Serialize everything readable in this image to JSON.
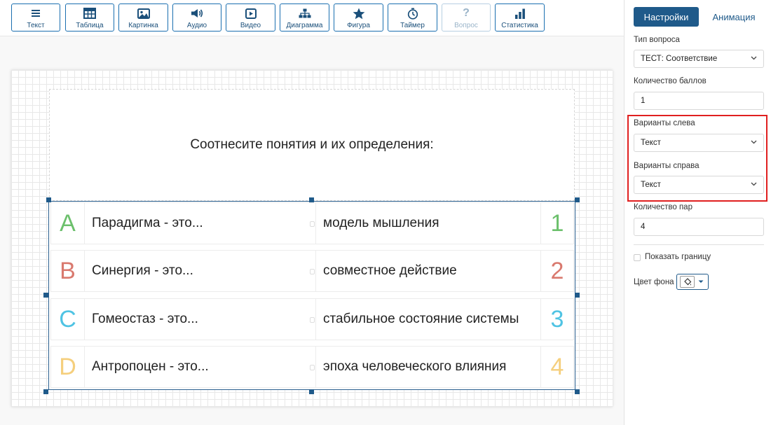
{
  "toolbar": {
    "items": [
      {
        "label": "Текст",
        "icon": "text-lines-icon",
        "disabled": false
      },
      {
        "label": "Таблица",
        "icon": "table-icon",
        "disabled": false
      },
      {
        "label": "Картинка",
        "icon": "image-icon",
        "disabled": false
      },
      {
        "label": "Аудио",
        "icon": "speaker-icon",
        "disabled": false
      },
      {
        "label": "Видео",
        "icon": "play-icon",
        "disabled": false
      },
      {
        "label": "Диаграмма",
        "icon": "hierarchy-icon",
        "disabled": false
      },
      {
        "label": "Фигура",
        "icon": "star-icon",
        "disabled": false
      },
      {
        "label": "Таймер",
        "icon": "stopwatch-icon",
        "disabled": false
      },
      {
        "label": "Вопрос",
        "icon": "question-icon",
        "disabled": true
      },
      {
        "label": "Статистика",
        "icon": "bar-chart-icon",
        "disabled": false
      }
    ]
  },
  "question": {
    "text": "Соотнесите понятия и их определения:",
    "pairs": [
      {
        "letter": "A",
        "letter_color": "#6cc06c",
        "left": "Парадигма - это...",
        "right": "модель мышления",
        "number": "1",
        "number_color": "#6cc06c"
      },
      {
        "letter": "B",
        "letter_color": "#d9796e",
        "left": "Синергия - это...",
        "right": "совместное действие",
        "number": "2",
        "number_color": "#d9796e"
      },
      {
        "letter": "C",
        "letter_color": "#4fc3e3",
        "left": "Гомеостаз - это...",
        "right": "стабильное состояние системы",
        "number": "3",
        "number_color": "#4fc3e3"
      },
      {
        "letter": "D",
        "letter_color": "#f5cf7d",
        "left": "Антропоцен - это...",
        "right": "эпоха человеческого влияния",
        "number": "4",
        "number_color": "#f5cf7d"
      }
    ]
  },
  "panel": {
    "tab_settings": "Настройки",
    "tab_animation": "Анимация",
    "question_type_label": "Тип вопроса",
    "question_type_value": "ТЕСТ: Соответствие",
    "points_label": "Количество баллов",
    "points_value": "1",
    "left_options_label": "Варианты слева",
    "left_options_value": "Текст",
    "right_options_label": "Варианты справа",
    "right_options_value": "Текст",
    "pairs_label": "Количество пар",
    "pairs_value": "4",
    "show_border_label": "Показать границу",
    "bg_color_label": "Цвет фона"
  },
  "colors": {
    "accent": "#1f5a8a",
    "highlight": "#e01f1f"
  }
}
